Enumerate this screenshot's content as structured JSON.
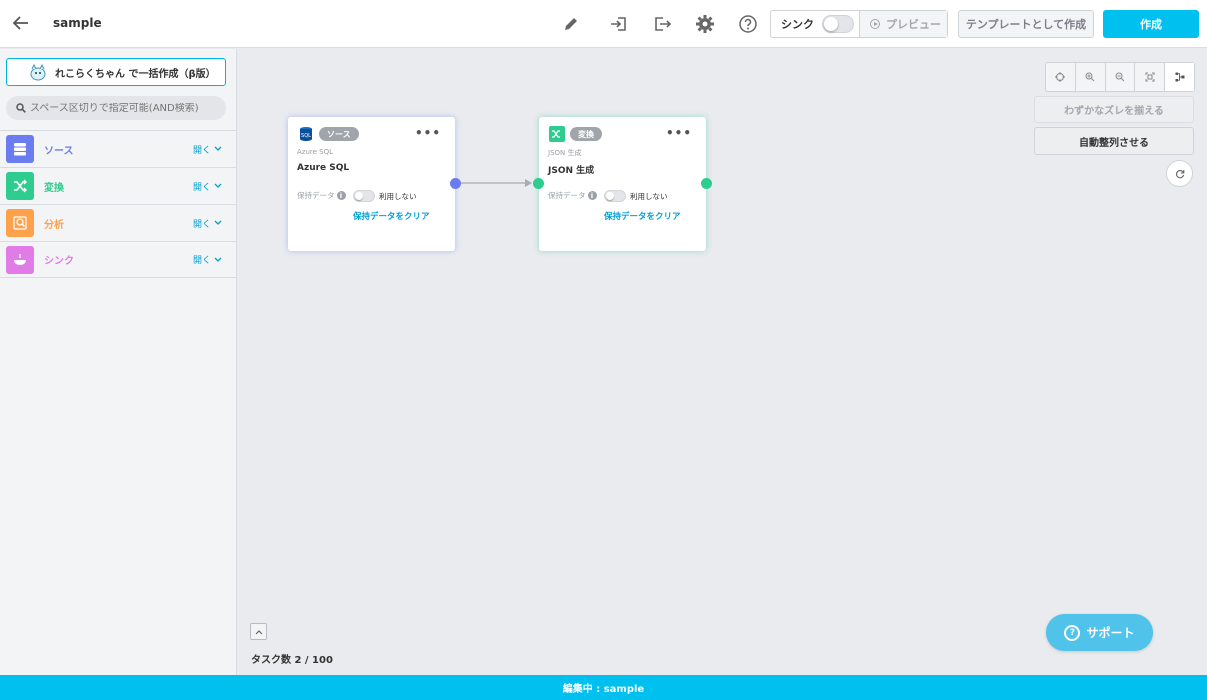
{
  "header": {
    "title": "sample",
    "sync_label": "シンク",
    "preview_label": "プレビュー",
    "template_label": "テンプレートとして作成",
    "create_label": "作成"
  },
  "sidebar": {
    "bulk_create_label": "れこらくちゃん で一括作成（β版）",
    "search_placeholder": "スペース区切りで指定可能(AND検索)",
    "categories": [
      {
        "label": "ソース",
        "open": "開く",
        "color": "#6b7cf0",
        "icon": "database-icon"
      },
      {
        "label": "変換",
        "open": "開く",
        "color": "#2ecc8f",
        "icon": "shuffle-icon"
      },
      {
        "label": "分析",
        "open": "開く",
        "color": "#ffa14a",
        "icon": "analysis-icon"
      },
      {
        "label": "シンク",
        "open": "開く",
        "color": "#e07be8",
        "icon": "sink-icon"
      }
    ]
  },
  "nodes": [
    {
      "badge": "ソース",
      "subtitle": "Azure SQL",
      "name": "Azure SQL",
      "keep_label": "保持データ",
      "toggle_label": "利用しない",
      "clear_label": "保持データをクリア"
    },
    {
      "badge": "変換",
      "subtitle": "JSON 生成",
      "name": "JSON 生成",
      "keep_label": "保持データ",
      "toggle_label": "利用しない",
      "clear_label": "保持データをクリア"
    }
  ],
  "canvas": {
    "align_label": "わずかなズレを揃える",
    "auto_arrange_label": "自動整列させる",
    "task_count": "タスク数 2 / 100",
    "support_label": "サポート"
  },
  "footer": {
    "status": "編集中 : sample"
  },
  "colors": {
    "accent": "#00c0ef",
    "source": "#6b7cf0",
    "transform": "#2ecc8f",
    "analysis": "#ffa14a",
    "sink": "#e07be8"
  }
}
